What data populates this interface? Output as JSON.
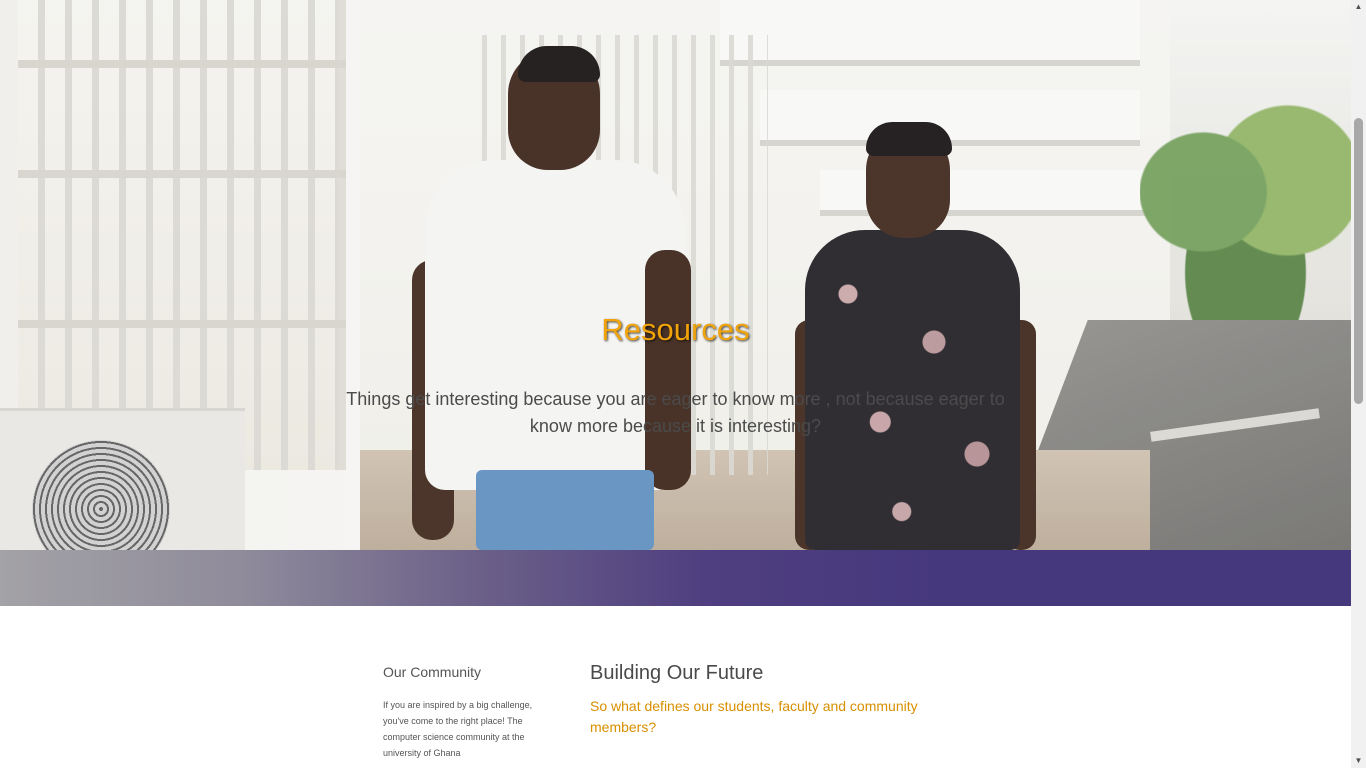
{
  "hero": {
    "title": "Resources",
    "subtitle": "Things get interesting because you are eager to know more , not because eager to know more because it is interesting?"
  },
  "community": {
    "title": "Our Community",
    "text": "If you are inspired by a big challenge, you've come to the right place! The computer science community at the university of Ghana"
  },
  "future": {
    "title": "Building Our Future",
    "subtitle": "So what defines our students, faculty and community members?"
  },
  "colors": {
    "accent": "#f0a30a",
    "accent_text": "#d88f00",
    "band_purple": "#46387d"
  },
  "icons": {
    "scroll_up": "chevron-up-icon",
    "scroll_down": "chevron-down-icon"
  }
}
